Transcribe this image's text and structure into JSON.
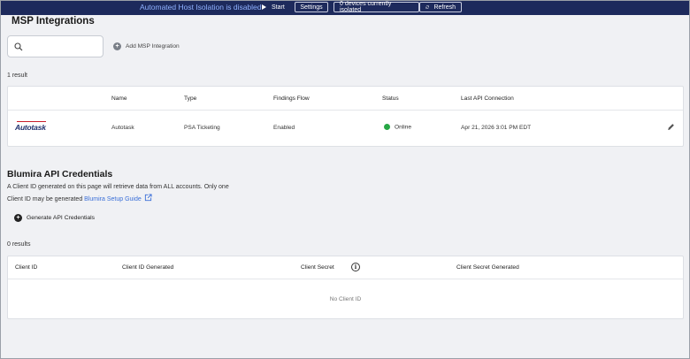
{
  "banner": {
    "message": "Automated Host Isolation is disabled",
    "start_label": "Start",
    "settings_label": "Settings",
    "isolated_label": "0 devices currently isolated",
    "refresh_label": "Refresh"
  },
  "page": {
    "title": "MSP Integrations"
  },
  "search": {
    "placeholder": ""
  },
  "msp": {
    "add_label": "Add MSP Integration",
    "result_count": "1 result",
    "columns": [
      "Name",
      "Type",
      "Findings Flow",
      "Status",
      "Last API Connection"
    ],
    "rows": [
      {
        "logo": "Autotask",
        "name": "Autotask",
        "type": "PSA Ticketing",
        "findings_flow": "Enabled",
        "status": "Online",
        "status_color": "#27a745",
        "last_connection": "Apr 21, 2026 3:01 PM EDT"
      }
    ]
  },
  "api": {
    "title": "Blumira API Credentials",
    "desc_line1": "A Client ID generated on this page will retrieve data from ALL accounts. Only one",
    "desc_line2": "Client ID may be generated",
    "guide_link": "Blumira Setup Guide",
    "generate_label": "Generate API Credentials",
    "result_count": "0 results",
    "columns": [
      "Client ID",
      "Client ID Generated",
      "Client Secret",
      "Client Secret Generated"
    ],
    "info_glyph": "i",
    "empty_text": "No Client ID"
  },
  "icons": {
    "search": "search-icon",
    "add": "plus-circle-icon",
    "edit": "pencil-icon",
    "refresh": "refresh-icon",
    "info": "info-icon",
    "external": "external-link-icon",
    "start": "play-icon"
  },
  "colors": {
    "banner_bg": "#1d2a5c",
    "banner_text": "#8fb1ff",
    "link": "#3a6fd8",
    "online": "#27a745"
  }
}
